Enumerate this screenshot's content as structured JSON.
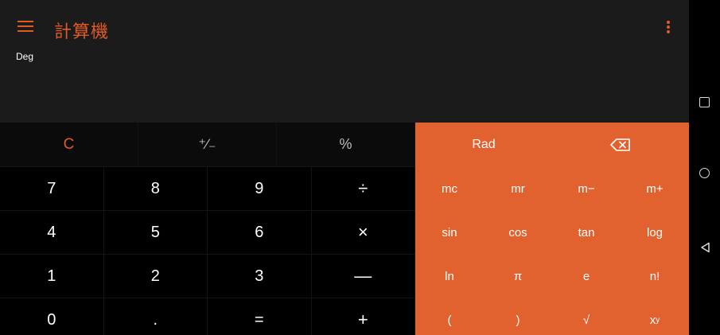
{
  "app": {
    "title": "計算機",
    "mode": "Deg",
    "accent_color": "#e05a26",
    "icons": {
      "menu": "hamburger-menu-icon",
      "overflow": "vertical-dots-icon"
    }
  },
  "basic_keys": {
    "top": [
      "C",
      "⁺∕₋",
      "%"
    ],
    "rows": [
      [
        "7",
        "8",
        "9",
        "÷"
      ],
      [
        "4",
        "5",
        "6",
        "×"
      ],
      [
        "1",
        "2",
        "3",
        "—"
      ],
      [
        "0",
        ".",
        "=",
        "+"
      ]
    ]
  },
  "sci_keys": {
    "top": [
      "Rad",
      "backspace-icon"
    ],
    "rows": [
      [
        "mc",
        "mr",
        "m−",
        "m+"
      ],
      [
        "sin",
        "cos",
        "tan",
        "log"
      ],
      [
        "ln",
        "π",
        "e",
        "n!"
      ],
      [
        "(",
        ")",
        "√",
        "x^y"
      ]
    ]
  },
  "system_nav": [
    "recents-square-icon",
    "home-circle-icon",
    "back-triangle-icon"
  ]
}
